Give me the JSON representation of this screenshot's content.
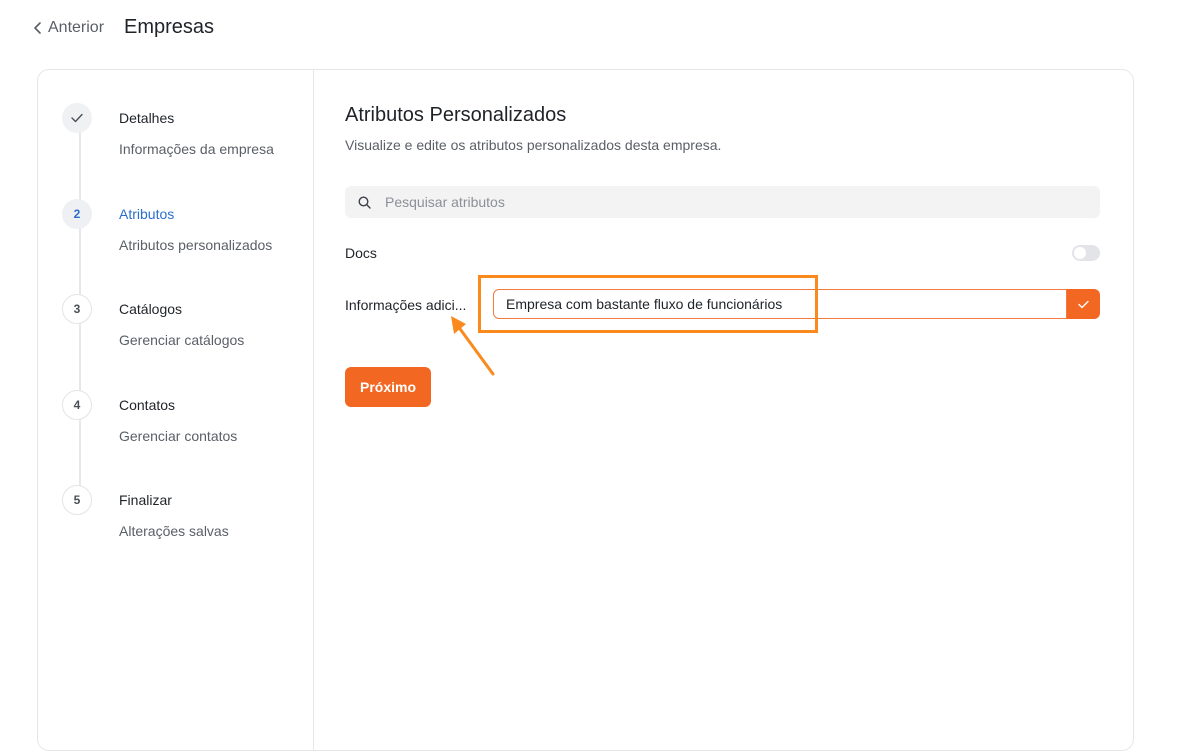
{
  "header": {
    "back_label": "Anterior",
    "title": "Empresas"
  },
  "steps": [
    {
      "marker": "",
      "title": "Detalhes",
      "subtitle": "Informações da empresa",
      "state": "done"
    },
    {
      "marker": "2",
      "title": "Atributos",
      "subtitle": "Atributos personalizados",
      "state": "active"
    },
    {
      "marker": "3",
      "title": "Catálogos",
      "subtitle": "Gerenciar catálogos",
      "state": "pending"
    },
    {
      "marker": "4",
      "title": "Contatos",
      "subtitle": "Gerenciar contatos",
      "state": "pending"
    },
    {
      "marker": "5",
      "title": "Finalizar",
      "subtitle": "Alterações salvas",
      "state": "pending"
    }
  ],
  "main": {
    "title": "Atributos Personalizados",
    "description": "Visualize e edite os atributos personalizados desta empresa.",
    "search": {
      "placeholder": "Pesquisar atributos"
    },
    "attributes": [
      {
        "label": "Docs",
        "type": "toggle",
        "enabled": false
      },
      {
        "label": "Informações adici...",
        "type": "text",
        "value": "Empresa com bastante fluxo de funcionários"
      }
    ],
    "next_label": "Próximo"
  },
  "colors": {
    "accent": "#f26722",
    "active_step": "#2c6ecb",
    "annotation": "#fa8a1d"
  }
}
